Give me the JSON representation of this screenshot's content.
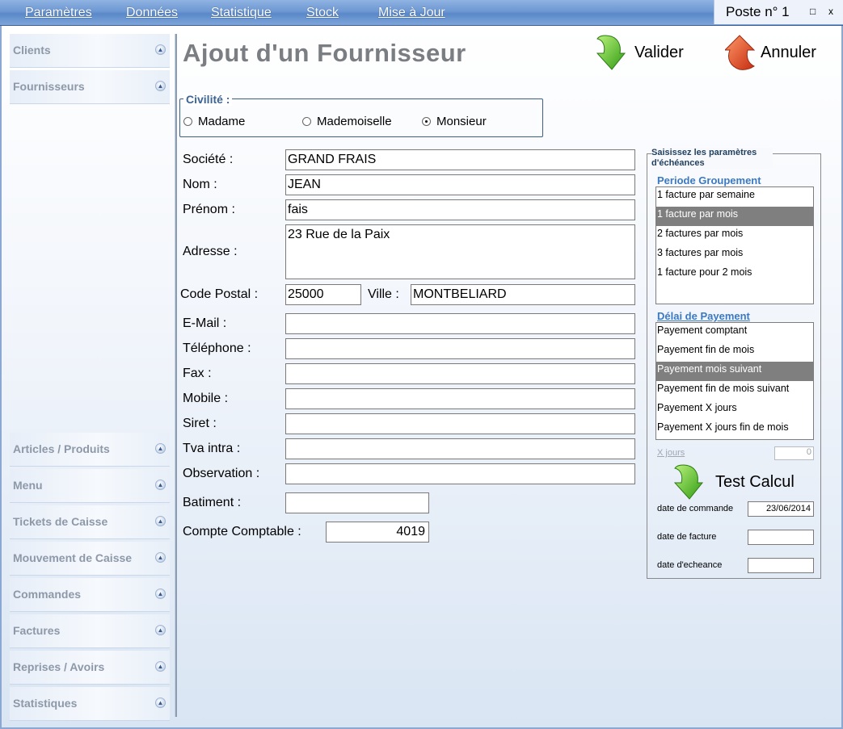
{
  "menu": {
    "items": [
      "Paramètres",
      "Données",
      "Statistique",
      "Stock",
      "Mise à Jour"
    ],
    "poste": "Poste n° 1",
    "restore_glyph": "□",
    "close_glyph": "x"
  },
  "sidebar": {
    "top_items": [
      "Clients",
      "Fournisseurs"
    ],
    "bottom_items": [
      "Articles / Produits",
      "Menu",
      "Tickets de Caisse",
      "Mouvement de Caisse",
      "Commandes",
      "Factures",
      "Reprises / Avoirs",
      "Statistiques"
    ],
    "chevron_glyph": "▲"
  },
  "page": {
    "title": "Ajout d'un Fournisseur",
    "validate_label": "Valider",
    "cancel_label": "Annuler",
    "validate_icon": "green-arrow-down-icon",
    "cancel_icon": "red-arrow-up-icon"
  },
  "civilite": {
    "legend": "Civilité :",
    "options": [
      "Madame",
      "Mademoiselle",
      "Monsieur"
    ],
    "selected": "Monsieur"
  },
  "form": {
    "societe": {
      "label": "Société :",
      "value": "GRAND FRAIS"
    },
    "nom": {
      "label": "Nom :",
      "value": "JEAN"
    },
    "prenom": {
      "label": "Prénom :",
      "value": "fais"
    },
    "adresse": {
      "label": "Adresse :",
      "value": "23 Rue de la Paix"
    },
    "code_postal": {
      "label": "Code Postal :",
      "value": "25000"
    },
    "ville": {
      "label": "Ville :",
      "value": "MONTBELIARD"
    },
    "email": {
      "label": "E-Mail :",
      "value": ""
    },
    "telephone": {
      "label": "Téléphone :",
      "value": ""
    },
    "fax": {
      "label": "Fax :",
      "value": ""
    },
    "mobile": {
      "label": "Mobile :",
      "value": ""
    },
    "siret": {
      "label": "Siret :",
      "value": ""
    },
    "tva": {
      "label": "Tva intra :",
      "value": ""
    },
    "observation": {
      "label": "Observation :",
      "value": ""
    },
    "batiment": {
      "label": "Batiment :",
      "value": ""
    },
    "compte": {
      "label": "Compte Comptable :",
      "value": "4019"
    }
  },
  "echeances": {
    "legend": "Saisissez les paramètres d'échéances",
    "periode_title": "Periode Groupement",
    "periode_items": [
      "1 facture par semaine",
      "1 facture par mois",
      "2 factures par mois",
      "3 factures par mois",
      "1 facture  pour 2 mois"
    ],
    "periode_selected": 1,
    "delai_title": "Délai de Payement",
    "delai_items": [
      "Payement comptant",
      "Payement fin de mois",
      "Payement mois suivant",
      "Payement fin de mois suivant",
      "Payement X jours",
      "Payement X jours fin de mois"
    ],
    "delai_selected": 2,
    "xjours_label": "X jours",
    "xjours_value": "0",
    "test_label": "Test Calcul",
    "date_commande_label": "date de commande",
    "date_commande_value": "23/06/2014",
    "date_facture_label": "date de facture",
    "date_facture_value": "",
    "date_echeance_label": "date d'echeance",
    "date_echeance_value": ""
  }
}
